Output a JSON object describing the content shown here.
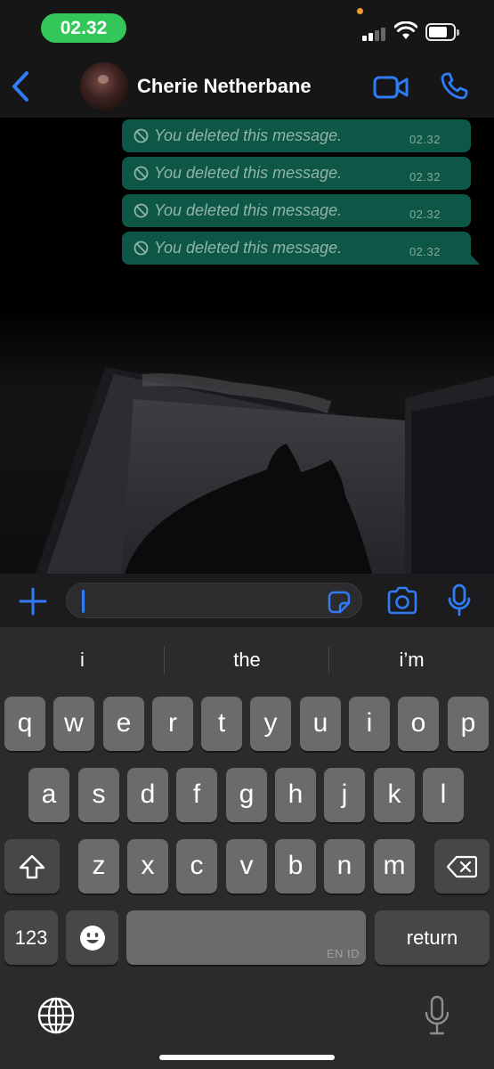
{
  "status_bar": {
    "time": "02.32",
    "colors": {
      "time_pill": "#33c75a",
      "privacy_dot": "#f29a2e"
    },
    "icons": [
      "signal-icon",
      "wifi-icon",
      "battery-icon"
    ]
  },
  "header": {
    "contact_name": "Cherie Netherbane",
    "icons": [
      "back-chevron-icon",
      "avatar",
      "video-call-icon",
      "phone-icon"
    ],
    "accent": "#2f7cf6"
  },
  "messages": [
    {
      "text": "You deleted this message.",
      "time": "02.32",
      "icon": "deleted-icon"
    },
    {
      "text": "You deleted this message.",
      "time": "02.32",
      "icon": "deleted-icon"
    },
    {
      "text": "You deleted this message.",
      "time": "02.32",
      "icon": "deleted-icon"
    },
    {
      "text": "You deleted this message.",
      "time": "02.32",
      "icon": "deleted-icon"
    }
  ],
  "bubble_color": "#0e5746",
  "input_bar": {
    "value": "",
    "icons": [
      "plus-icon",
      "sticker-icon",
      "camera-icon",
      "microphone-icon"
    ]
  },
  "keyboard": {
    "suggestions": [
      "i",
      "the",
      "i’m"
    ],
    "rows": [
      [
        "q",
        "w",
        "e",
        "r",
        "t",
        "y",
        "u",
        "i",
        "o",
        "p"
      ],
      [
        "a",
        "s",
        "d",
        "f",
        "g",
        "h",
        "j",
        "k",
        "l"
      ],
      [
        "z",
        "x",
        "c",
        "v",
        "b",
        "n",
        "m"
      ]
    ],
    "numbers_label": "123",
    "return_label": "return",
    "space_language": "EN ID",
    "icons": [
      "shift-icon",
      "delete-icon",
      "emoji-icon",
      "globe-icon",
      "dictation-icon"
    ]
  }
}
